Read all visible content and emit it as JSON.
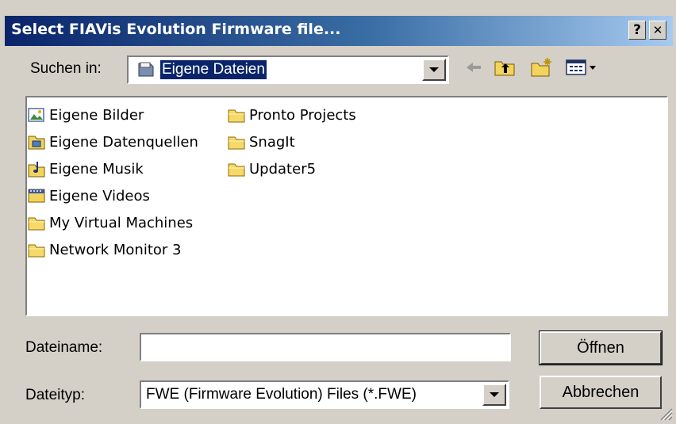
{
  "window": {
    "title": "Select FIAVis Evolution Firmware file...",
    "help_label": "?",
    "close_label": "✕"
  },
  "lookin": {
    "label": "Suchen in:",
    "value": "Eigene Dateien"
  },
  "files": [
    {
      "name": "Eigene Bilder",
      "icon": "pictures-folder-icon"
    },
    {
      "name": "Eigene Datenquellen",
      "icon": "datasource-folder-icon"
    },
    {
      "name": "Eigene Musik",
      "icon": "music-folder-icon"
    },
    {
      "name": "Eigene Videos",
      "icon": "video-folder-icon"
    },
    {
      "name": "My Virtual Machines",
      "icon": "folder-icon"
    },
    {
      "name": "Network Monitor 3",
      "icon": "folder-icon"
    },
    {
      "name": "Pronto Projects",
      "icon": "folder-icon"
    },
    {
      "name": "SnagIt",
      "icon": "folder-icon"
    },
    {
      "name": "Updater5",
      "icon": "folder-icon"
    }
  ],
  "filename": {
    "label": "Dateiname:",
    "value": ""
  },
  "filetype": {
    "label": "Dateityp:",
    "value": "FWE (Firmware Evolution) Files (*.FWE)"
  },
  "buttons": {
    "open": "Öffnen",
    "cancel": "Abbrechen"
  },
  "colors": {
    "title_start": "#0a246a",
    "title_end": "#a6caf0",
    "selection": "#0a246a",
    "face": "#d4d0c8"
  }
}
